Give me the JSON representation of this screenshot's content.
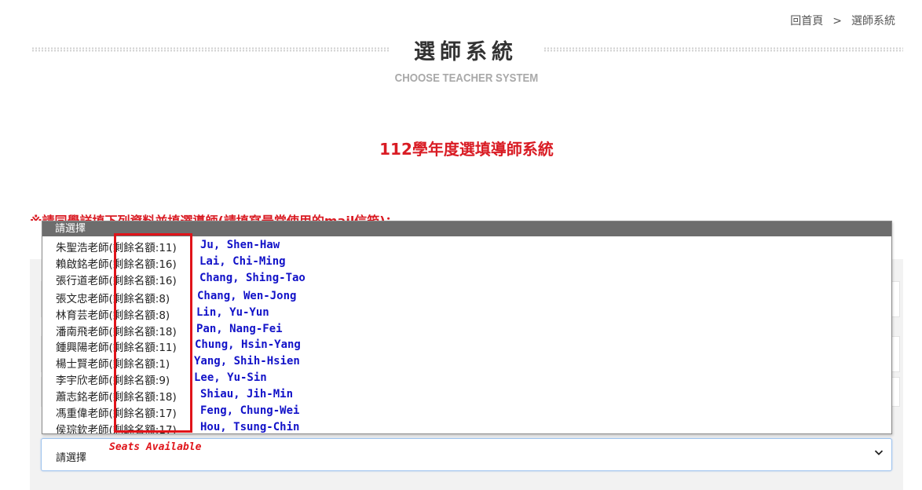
{
  "breadcrumb": {
    "home": "回首頁",
    "separator": ">",
    "current": "選師系統"
  },
  "header": {
    "title": "選師系統",
    "subtitle": "CHOOSE TEACHER SYSTEM"
  },
  "system_heading": "112學年度選填導師系統",
  "notice": "※請同學詳填下列資料並填選導師(請填寫最常使用的mail信箱)：",
  "select": {
    "value": "請選擇"
  },
  "dropdown": {
    "header": "請選擇",
    "options": [
      {
        "label": "朱聖浩老師(剩餘名額:11)",
        "english": "Ju, Shen-Haw"
      },
      {
        "label": "賴啟銘老師(剩餘名額:16)",
        "english": "Lai, Chi-Ming"
      },
      {
        "label": "張行道老師(剩餘名額:16)",
        "english": "Chang, Shing-Tao"
      },
      {
        "label": "張文忠老師(剩餘名額:8)",
        "english": "Chang, Wen-Jong"
      },
      {
        "label": "林育芸老師(剩餘名額:8)",
        "english": "Lin, Yu-Yun"
      },
      {
        "label": "潘南飛老師(剩餘名額:18)",
        "english": "Pan, Nang-Fei"
      },
      {
        "label": "鍾興陽老師(剩餘名額:11)",
        "english": "Chung, Hsin-Yang"
      },
      {
        "label": "楊士賢老師(剩餘名額:1)",
        "english": "Yang, Shih-Hsien"
      },
      {
        "label": "李宇欣老師(剩餘名額:9)",
        "english": "Lee, Yu-Sin"
      },
      {
        "label": "蕭志銘老師(剩餘名額:18)",
        "english": "Shiau, Jih-Min"
      },
      {
        "label": "馮重偉老師(剩餘名額:17)",
        "english": "Feng, Chung-Wei"
      },
      {
        "label": "侯琮欽老師(剩餘名額:17)",
        "english": "Hou, Tsung-Chin"
      }
    ]
  },
  "annotation": {
    "seats_label": "Seats Available",
    "color": "#e0141a"
  },
  "colors": {
    "accent_red": "#d91c24",
    "english_blue": "#1212c8",
    "dropdown_header": "#6d6d6d"
  },
  "icons": {
    "select_chevron": "chevron-down-icon"
  }
}
